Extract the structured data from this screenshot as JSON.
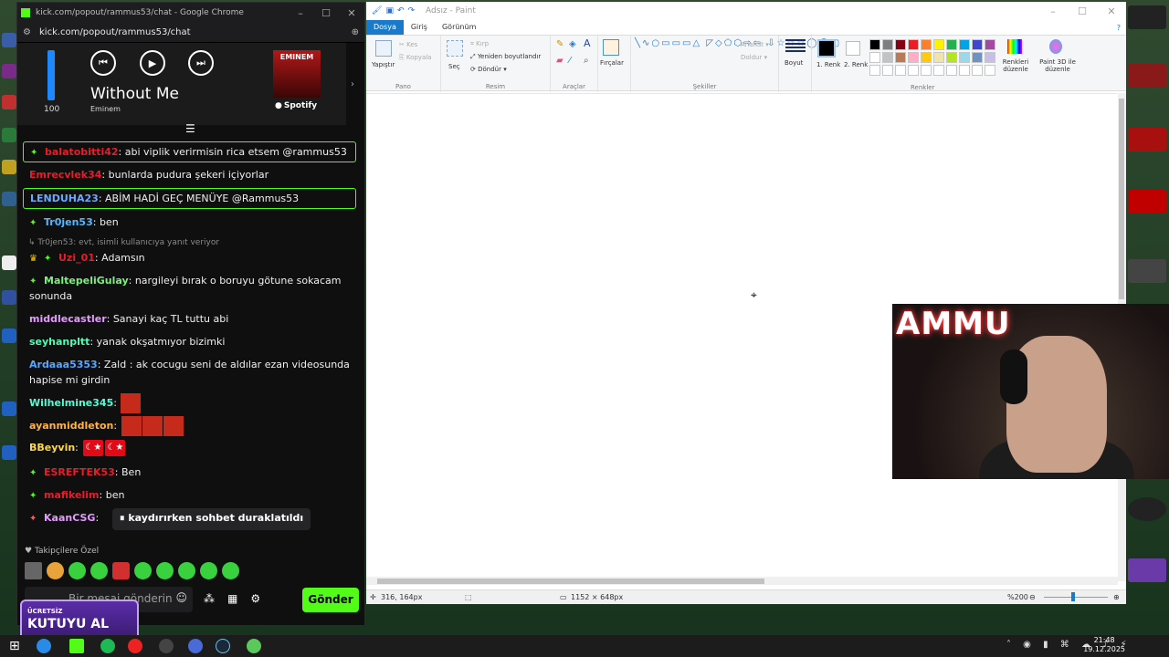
{
  "chrome": {
    "window_title": "kick.com/popout/rammus53/chat - Google Chrome",
    "url": "kick.com/popout/rammus53/chat"
  },
  "spotify": {
    "volume": 100,
    "volume_label": "100",
    "track": "Without Me",
    "artist": "Eminem",
    "album_art_text": "EMINEM",
    "brand": "Spotify"
  },
  "chat": {
    "messages": [
      {
        "user": "balatobitti42",
        "user_color": "#e61e2b",
        "text": "abi viplik verirmisin rica etsem @rammus53",
        "highlight": true
      },
      {
        "user": "Emrecvlek34",
        "user_color": "#e61e2b",
        "text": "bunlarda pudura şekeri içiyorlar",
        "highlight": false
      },
      {
        "user": "LENDUHA23",
        "user_color": "#6aa9ff",
        "text": "ABİM HADİ GEÇ MENÜYE @Rammus53",
        "highlight": true
      },
      {
        "user": "Tr0jen53",
        "user_color": "#53b7ff",
        "text": "ben",
        "highlight": false
      },
      {
        "user": "Uzi_01",
        "user_color": "#e61e2b",
        "text": "Adamsın",
        "highlight": false,
        "reply": "Tr0jen53: evt, isimli kullanıcıya yanıt veriyor"
      },
      {
        "user": "MaltepeliGulay",
        "user_color": "#7cf07c",
        "text": "nargileyi bırak o boruyu götune sokacam sonunda",
        "highlight": false
      },
      {
        "user": "middlecastler",
        "user_color": "#e39bff",
        "text": "Sanayi kaç TL tuttu abi",
        "highlight": false
      },
      {
        "user": "seyhanpltt",
        "user_color": "#53fcb6",
        "text": "yanak okşatmıyor bizimki",
        "highlight": false
      },
      {
        "user": "Ardaaa5353",
        "user_color": "#53a8ff",
        "text": "Zald : ak cocugu seni de aldılar ezan videosunda hapise mi girdin",
        "highlight": false
      },
      {
        "user": "Wilhelmine345",
        "user_color": "#53fcd6",
        "text": "",
        "highlight": false
      },
      {
        "user": "ayanmiddleton",
        "user_color": "#ffb347",
        "text": "",
        "highlight": false
      },
      {
        "user": "BBeyvin",
        "user_color": "#ffd84a",
        "text": "",
        "highlight": false
      },
      {
        "user": "ESREFTEK53",
        "user_color": "#e61e2b",
        "text": "Ben",
        "highlight": false
      },
      {
        "user": "mafikelim",
        "user_color": "#e61e2b",
        "text": "ben",
        "highlight": false
      },
      {
        "user": "KaanCSG",
        "user_color": "#e39bff",
        "text": "",
        "highlight": false
      }
    ],
    "paused_notice": "kaydırırken sohbet duraklatıldı",
    "emote_bar_label": "Takipçilere Özel",
    "input_placeholder": "Bir mesaj gönderin",
    "send_label": "Gönder"
  },
  "ad": {
    "small": "ÜCRETSİZ",
    "big": "KUTUYU AL"
  },
  "paint": {
    "window_title": "Adsız - Paint",
    "tabs": [
      "Dosya",
      "Giriş",
      "Görünüm"
    ],
    "pano": {
      "paste": "Yapıştır",
      "cut": "Kes",
      "copy": "Kopyala",
      "label": "Pano"
    },
    "resim": {
      "select": "Seç",
      "crop": "Kırp",
      "resize": "Yeniden boyutlandır",
      "rotate": "Döndür",
      "label": "Resim"
    },
    "araclar": {
      "label": "Araçlar"
    },
    "brushes": "Fırçalar",
    "sekiller": {
      "outline": "Anahat",
      "fill": "Doldur",
      "label": "Şekiller"
    },
    "size": "Boyut",
    "color1": "1. Renk",
    "color2": "2. Renk",
    "renkler": {
      "edit": "Renkleri düzenle",
      "paint3d": "Paint 3D ile düzenle",
      "label": "Renkler"
    },
    "palette": [
      "#000000",
      "#7f7f7f",
      "#880015",
      "#ed1c24",
      "#ff7f27",
      "#fff200",
      "#22b14c",
      "#00a2e8",
      "#3f48cc",
      "#a349a4",
      "#ffffff",
      "#c3c3c3",
      "#b97a57",
      "#ffaec9",
      "#ffc90e",
      "#efe4b0",
      "#b5e61d",
      "#99d9ea",
      "#7092be",
      "#c8bfe7",
      "#ffffff",
      "#ffffff",
      "#ffffff",
      "#ffffff",
      "#ffffff",
      "#ffffff",
      "#ffffff",
      "#ffffff",
      "#ffffff",
      "#ffffff"
    ],
    "status": {
      "cursor_pos": "316, 164px",
      "canvas_size": "1152 × 648px",
      "zoom": "%200"
    }
  },
  "webcam": {
    "sign_text": "AMMU"
  },
  "taskbar": {
    "time": "21:48",
    "date": "19.12.2025"
  }
}
